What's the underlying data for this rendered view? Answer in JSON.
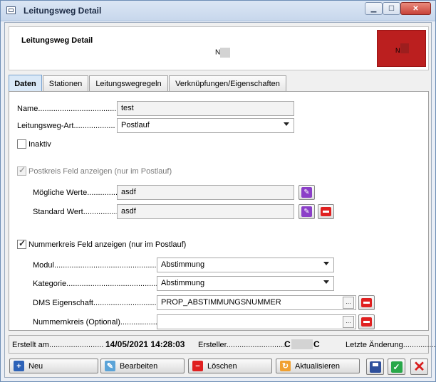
{
  "window": {
    "title": "Leitungsweg Detail"
  },
  "header": {
    "title": "Leitungsweg Detail",
    "sub_prefix": "N",
    "logo_text": "N"
  },
  "tabs": [
    "Daten",
    "Stationen",
    "Leitungswegregeln",
    "Verknüpfungen/Eigenschaften"
  ],
  "form": {
    "name_label": "Name.......................................",
    "name_value": "test",
    "art_label": "Leitungsweg-Art...................",
    "art_value": "Postlauf",
    "inaktiv_label": "Inaktiv",
    "postkreis_label": "Postkreis Feld anzeigen (nur im Postlauf)",
    "moegliche_label": "Mögliche Werte...................",
    "moegliche_value": "asdf",
    "standard_label": "Standard Wert......................",
    "standard_value": "asdf",
    "nummerkreis_label": "Nummerkreis Feld anzeigen (nur im Postlauf)",
    "modul_label": "Modul.........................................................",
    "modul_value": "Abstimmung",
    "kategorie_label": "Kategorie...................................................",
    "kategorie_value": "Abstimmung",
    "dms_label": "DMS Eigenschaft.......................................",
    "dms_value": "PROP_ABSTIMMUNGSNUMMER",
    "nummernkreis_label": "Nummernkreis (Optional).........................",
    "nummernkreis_value": ""
  },
  "status": {
    "erstellt_label": "Erstellt am.........................",
    "erstellt_value": "14/05/2021 14:28:03",
    "ersteller_label": "Ersteller.............................",
    "ersteller_value": "C",
    "ersteller_value_end": "C",
    "aenderung_label": "Letzte Änderung..................."
  },
  "toolbar": {
    "neu": "Neu",
    "bearbeiten": "Bearbeiten",
    "loeschen": "Löschen",
    "aktualisieren": "Aktualisieren"
  },
  "checkboxes": {
    "inaktiv": false,
    "postkreis": true,
    "nummerkreis": true
  }
}
